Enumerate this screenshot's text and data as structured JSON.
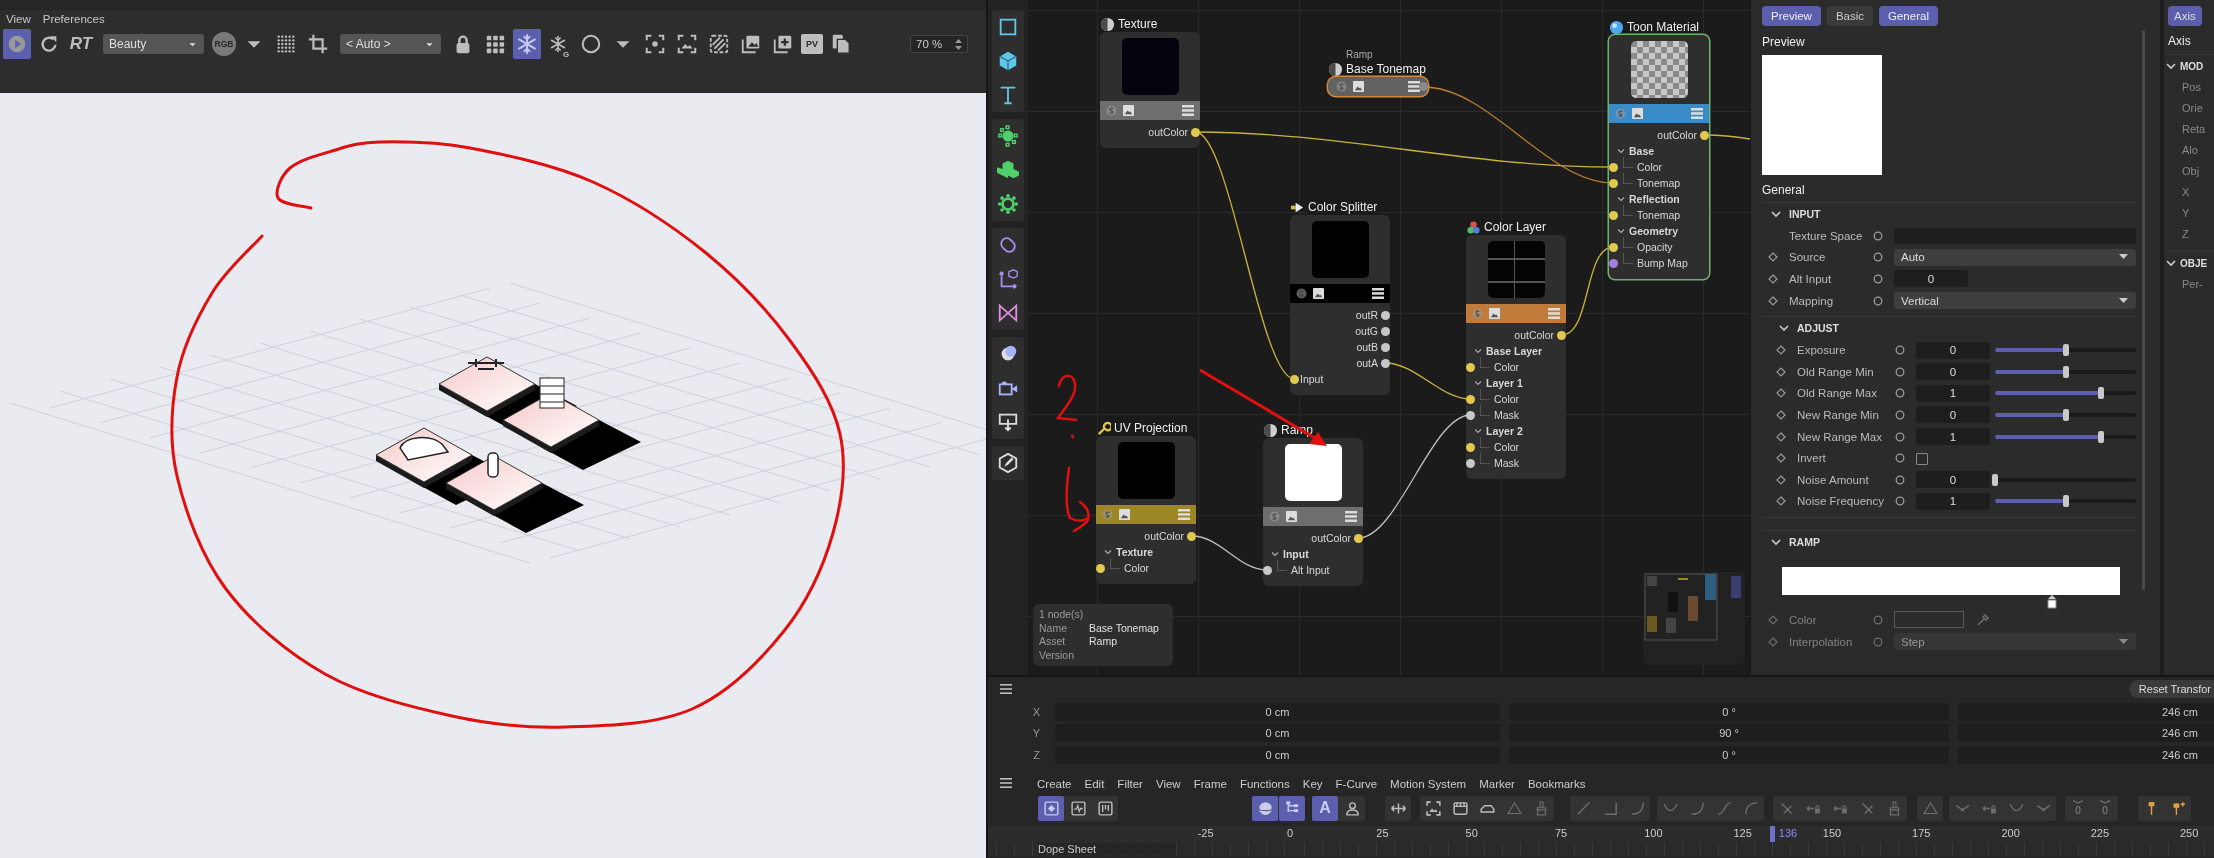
{
  "viewport": {
    "menu": [
      "View",
      "Preferences"
    ],
    "toolbar": [
      {
        "kind": "play",
        "selected": true
      },
      {
        "kind": "refresh",
        "selected": false
      },
      {
        "kind": "label",
        "text": "RT",
        "selected": false
      },
      {
        "kind": "dropdown",
        "value": "Beauty",
        "selected": false
      },
      {
        "kind": "rgb",
        "text": "RGB",
        "selected": false
      },
      {
        "kind": "caret",
        "selected": false
      },
      {
        "kind": "dots",
        "selected": false
      },
      {
        "kind": "crop",
        "selected": false
      },
      {
        "kind": "dropdown",
        "value": "< Auto >",
        "selected": false
      },
      {
        "kind": "lock",
        "selected": false
      },
      {
        "kind": "grid",
        "selected": false
      },
      {
        "kind": "snowflake",
        "selected": true
      },
      {
        "kind": "snowflake_g",
        "text": "G",
        "selected": false
      },
      {
        "kind": "circle",
        "selected": false
      },
      {
        "kind": "caret",
        "selected": false
      },
      {
        "kind": "focus",
        "selected": false
      },
      {
        "kind": "frame",
        "selected": false
      },
      {
        "kind": "hatch",
        "selected": false
      },
      {
        "kind": "images",
        "selected": false
      },
      {
        "kind": "add",
        "selected": false
      },
      {
        "kind": "badge",
        "text": "PV",
        "selected": false
      },
      {
        "kind": "copy",
        "selected": false
      }
    ],
    "zoom": "70 %"
  },
  "node_editor": {
    "nodes": [
      {
        "title": "Texture",
        "kind": "texture",
        "collapsed": false,
        "selected": false,
        "color": "#6e6e6e",
        "outputs": [
          {
            "label": "outColor",
            "color": "#e2c84c"
          }
        ]
      },
      {
        "subtitle": "Ramp",
        "title": "Base Tonemap",
        "kind": "ramp",
        "collapsed": true,
        "selected": true,
        "color": "#626262"
      },
      {
        "title": "Color Splitter",
        "kind": "splitter",
        "collapsed": false,
        "selected": false,
        "color": "#000000",
        "outputs": [
          {
            "label": "outR",
            "color": "#c8c8c8"
          },
          {
            "label": "outG",
            "color": "#c8c8c8"
          },
          {
            "label": "outB",
            "color": "#c8c8c8"
          },
          {
            "label": "outA",
            "color": "#c8c8c8"
          }
        ],
        "inputs": [
          {
            "label": "Input",
            "color": "#e2c84c"
          }
        ]
      },
      {
        "title": "Color Layer",
        "kind": "layer",
        "collapsed": false,
        "selected": false,
        "color": "#c07a3a",
        "outputs": [
          {
            "label": "outColor",
            "color": "#e2c84c"
          }
        ],
        "inputs": [
          {
            "label": "Base Layer",
            "expanded": true,
            "children": [
              {
                "label": "Color",
                "color": "#e2c84c"
              }
            ]
          },
          {
            "label": "Layer 1",
            "expanded": true,
            "children": [
              {
                "label": "Color",
                "color": "#e2c84c"
              },
              {
                "label": "Mask",
                "color": "#c8c8c8"
              }
            ]
          },
          {
            "label": "Layer 2",
            "expanded": true,
            "children": [
              {
                "label": "Color",
                "color": "#e2c84c"
              },
              {
                "label": "Mask",
                "color": "#c8c8c8"
              }
            ]
          }
        ]
      },
      {
        "title": "Toon Material",
        "kind": "material",
        "collapsed": false,
        "selected": false,
        "color": "#3a8cc8",
        "outputs": [
          {
            "label": "outColor",
            "color": "#e2c84c"
          }
        ],
        "inputs": [
          {
            "label": "Base",
            "expanded": true,
            "children": [
              {
                "label": "Color",
                "color": "#e2c84c"
              },
              {
                "label": "Tonemap",
                "color": "#e2c84c"
              }
            ]
          },
          {
            "label": "Reflection",
            "expanded": true,
            "children": [
              {
                "label": "Tonemap",
                "color": "#e2c84c"
              }
            ]
          },
          {
            "label": "Geometry",
            "expanded": true,
            "children": [
              {
                "label": "Opacity",
                "color": "#e2c84c"
              },
              {
                "label": "Bump Map",
                "color": "#a77ce0"
              }
            ]
          }
        ]
      },
      {
        "title": "UV Projection",
        "kind": "projection",
        "collapsed": false,
        "selected": false,
        "color": "#9c8626",
        "outputs": [
          {
            "label": "outColor",
            "color": "#e2c84c"
          }
        ],
        "inputs": [
          {
            "label": "Texture",
            "expanded": true,
            "children": [
              {
                "label": "Color",
                "color": "#e2c84c"
              }
            ]
          }
        ]
      },
      {
        "title": "Ramp",
        "kind": "ramp",
        "collapsed": false,
        "selected": false,
        "color": "#6e6e6e",
        "outputs": [
          {
            "label": "outColor",
            "color": "#e2c84c"
          }
        ],
        "inputs": [
          {
            "label": "Input",
            "expanded": true,
            "children": [
              {
                "label": "Alt Input",
                "color": "#c8c8c8"
              }
            ]
          }
        ]
      }
    ],
    "info": {
      "count": "1 node(s)",
      "fields": [
        {
          "label": "Name",
          "value": "Base Tonemap"
        },
        {
          "label": "Asset",
          "value": "Ramp"
        },
        {
          "label": "Version"
        }
      ]
    }
  },
  "attributes": {
    "tabs": [
      {
        "label": "Preview",
        "selected": true
      },
      {
        "label": "Basic",
        "selected": false
      },
      {
        "label": "General",
        "selected": true
      }
    ],
    "preview_heading": "Preview",
    "section_heading": "General",
    "groups": [
      {
        "title": "INPUT",
        "expanded": true,
        "rows": [
          {
            "kind": "field",
            "label": "Texture Space",
            "keyframe": false
          },
          {
            "kind": "dropdown",
            "label": "Source",
            "keyframe": true,
            "value": "Auto"
          },
          {
            "kind": "number",
            "label": "Alt Input",
            "keyframe": true,
            "value": "0"
          },
          {
            "kind": "dropdown",
            "label": "Mapping",
            "keyframe": true,
            "value": "Vertical"
          }
        ],
        "children": [
          {
            "title": "ADJUST",
            "expanded": true,
            "rows": [
              {
                "kind": "slider",
                "label": "Exposure",
                "keyframe": true,
                "value": "0",
                "level": 0.5
              },
              {
                "kind": "slider",
                "label": "Old Range Min",
                "keyframe": true,
                "value": "0",
                "level": 0.5
              },
              {
                "kind": "slider",
                "label": "Old Range Max",
                "keyframe": true,
                "value": "1",
                "level": 0.75
              },
              {
                "kind": "slider",
                "label": "New Range Min",
                "keyframe": true,
                "value": "0",
                "level": 0.5
              },
              {
                "kind": "slider",
                "label": "New Range Max",
                "keyframe": true,
                "value": "1",
                "level": 0.75
              },
              {
                "kind": "checkbox",
                "label": "Invert",
                "keyframe": true,
                "checked": false
              },
              {
                "kind": "slider",
                "label": "Noise Amount",
                "keyframe": true,
                "value": "0",
                "level": 0.0
              },
              {
                "kind": "slider",
                "label": "Noise Frequency",
                "keyframe": true,
                "value": "1",
                "level": 0.5
              }
            ]
          }
        ]
      },
      {
        "title": "RAMP",
        "expanded": true,
        "rows": [
          {
            "kind": "ramp",
            "level": 0.8,
            "disabled": false
          },
          {
            "kind": "color",
            "label": "Color",
            "keyframe": true,
            "disabled": true
          },
          {
            "kind": "dropdown",
            "label": "Interpolation",
            "keyframe": true,
            "value": "Step",
            "disabled": true
          }
        ]
      }
    ]
  },
  "side_panel": {
    "tab": {
      "label": "Axis",
      "selected": true
    },
    "heading": "Axis",
    "groups": [
      {
        "title": "MOD",
        "expanded": true,
        "rows": [
          "Pos",
          "Orie",
          "Reta",
          "Alo",
          "Obj",
          "X",
          "Y",
          "Z"
        ]
      },
      {
        "title": "OBJE",
        "expanded": true,
        "rows": [
          "Per-"
        ]
      }
    ]
  },
  "coordinates": {
    "reset_button": "Reset Transfor",
    "rows": [
      {
        "axis": "X",
        "values": [
          "0 cm",
          "0 °",
          "246 cm"
        ]
      },
      {
        "axis": "Y",
        "values": [
          "0 cm",
          "90 °",
          "246 cm"
        ]
      },
      {
        "axis": "Z",
        "values": [
          "0 cm",
          "0 °",
          "246 cm"
        ]
      }
    ]
  },
  "timeline": {
    "menu": [
      "Create",
      "Edit",
      "Filter",
      "View",
      "Frame",
      "Functions",
      "Key",
      "F-Curve",
      "Motion System",
      "Marker",
      "Bookmarks"
    ],
    "toolbar_groups": [
      [
        {
          "kind": "key",
          "selected": true,
          "disabled": false
        },
        {
          "kind": "wave",
          "selected": false,
          "disabled": false
        },
        {
          "kind": "bars",
          "selected": false,
          "disabled": false
        }
      ],
      [
        {
          "kind": "sphere",
          "selected": true,
          "disabled": false
        },
        {
          "kind": "tree",
          "selected": true,
          "disabled": false
        }
      ],
      [
        {
          "kind": "letter",
          "text": "A",
          "selected": true,
          "disabled": false
        },
        {
          "kind": "person",
          "selected": false,
          "disabled": false
        }
      ],
      [
        {
          "kind": "move",
          "selected": false,
          "disabled": false
        }
      ],
      [
        {
          "kind": "frame",
          "selected": false,
          "disabled": false
        },
        {
          "kind": "film",
          "selected": false,
          "disabled": false
        },
        {
          "kind": "tag",
          "selected": false,
          "disabled": false
        },
        {
          "kind": "triangle",
          "selected": false,
          "disabled": true
        },
        {
          "kind": "brush",
          "selected": false,
          "disabled": true
        }
      ],
      [
        {
          "kind": "line",
          "selected": false,
          "disabled": true
        },
        {
          "kind": "corner",
          "selected": false,
          "disabled": true
        },
        {
          "kind": "curve",
          "selected": false,
          "disabled": true
        }
      ],
      [
        {
          "kind": "ease",
          "selected": false,
          "disabled": true
        },
        {
          "kind": "curve",
          "selected": false,
          "disabled": true
        },
        {
          "kind": "scurve",
          "selected": false,
          "disabled": true
        },
        {
          "kind": "arc",
          "selected": false,
          "disabled": true
        }
      ],
      [
        {
          "kind": "slash",
          "selected": false,
          "disabled": true
        },
        {
          "kind": "keylock",
          "selected": false,
          "disabled": true
        },
        {
          "kind": "keylock",
          "selected": false,
          "disabled": true
        },
        {
          "kind": "slash",
          "selected": false,
          "disabled": true
        },
        {
          "kind": "brush",
          "selected": false,
          "disabled": true
        }
      ],
      [
        {
          "kind": "triangle",
          "selected": false,
          "disabled": true
        }
      ],
      [
        {
          "kind": "slope",
          "selected": false,
          "disabled": true
        },
        {
          "kind": "keylock",
          "selected": false,
          "disabled": true
        },
        {
          "kind": "ease",
          "selected": false,
          "disabled": true
        },
        {
          "kind": "slope",
          "selected": false,
          "disabled": true
        }
      ],
      [
        {
          "kind": "zero",
          "text": "0",
          "selected": false,
          "disabled": true
        },
        {
          "kind": "zero",
          "text": "0",
          "selected": false,
          "disabled": true
        }
      ],
      [
        {
          "kind": "pin",
          "selected": false,
          "disabled": false
        },
        {
          "kind": "pinplus",
          "selected": false,
          "disabled": false
        }
      ]
    ],
    "ruler": {
      "ticks": [
        "-25",
        "0",
        "25",
        "50",
        "75",
        "100",
        "125",
        "150",
        "175",
        "200",
        "225",
        "250"
      ],
      "current": "136"
    },
    "track_label": "Dope Sheet"
  }
}
